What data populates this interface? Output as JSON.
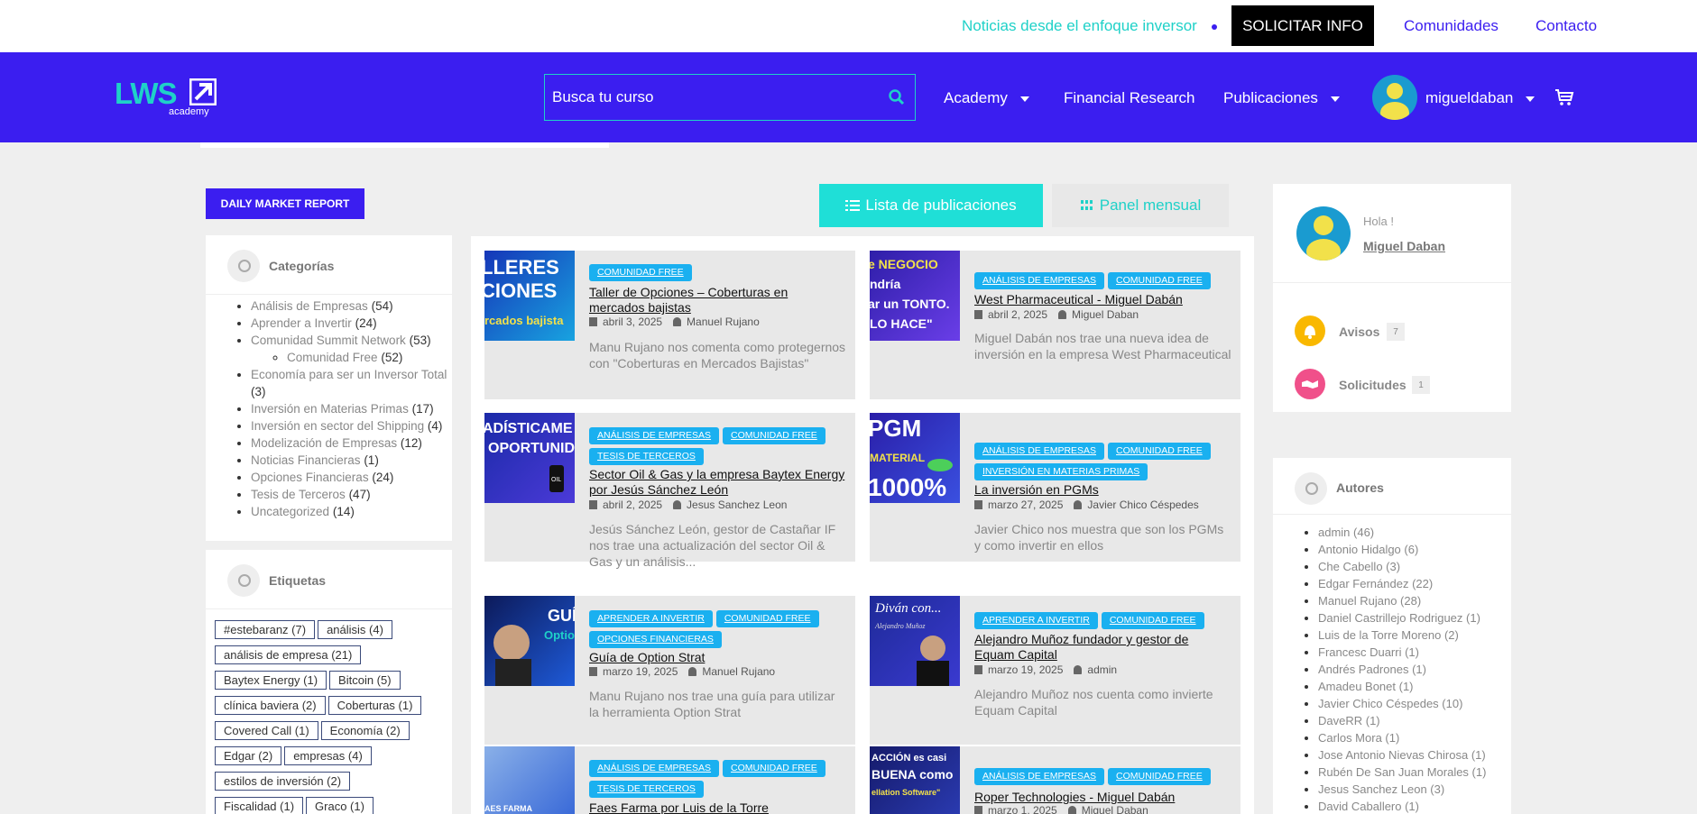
{
  "topbar": {
    "tagline": "Noticias desde el enfoque inversor",
    "cta": "SOLICITAR INFO",
    "links": [
      "Comunidades",
      "Contacto"
    ]
  },
  "header": {
    "logo_main": "LWS",
    "logo_sub": "academy",
    "search_placeholder": "Busca tu curso",
    "nav": [
      "Academy",
      "Financial Research",
      "Publicaciones"
    ],
    "user": "migueldaban",
    "colors": {
      "primary": "#3b1ef0",
      "accent": "#1fd1c8"
    }
  },
  "left": {
    "daily_button": "DAILY MARKET REPORT",
    "categorias_title": "Categorías",
    "categories": [
      {
        "name": "Análisis de Empresas",
        "count": "(54)"
      },
      {
        "name": "Aprender a Invertir",
        "count": "(24)"
      },
      {
        "name": "Comunidad Summit Network",
        "count": "(53)"
      },
      {
        "name": "Comunidad Free",
        "count": "(52)"
      },
      {
        "name": "Economía para ser un Inversor Total",
        "count": "(3)"
      },
      {
        "name": "Inversión en Materias Primas",
        "count": "(17)"
      },
      {
        "name": "Inversión en sector del Shipping",
        "count": "(4)"
      },
      {
        "name": "Modelización de Empresas",
        "count": "(12)"
      },
      {
        "name": "Noticias Financieras",
        "count": "(1)"
      },
      {
        "name": "Opciones Financieras",
        "count": "(24)"
      },
      {
        "name": "Tesis de Terceros",
        "count": "(47)"
      },
      {
        "name": "Uncategorized",
        "count": "(14)"
      }
    ],
    "etiquetas_title": "Etiquetas",
    "tags": [
      "#estebaranz (7)",
      "análisis (4)",
      "análisis de empresa (21)",
      "Baytex Energy (1)",
      "Bitcoin (5)",
      "clínica baviera (2)",
      "Coberturas (1)",
      "Covered Call (1)",
      "Economía (2)",
      "Edgar (2)",
      "empresas (4)",
      "estilos de inversión (2)",
      "Fiscalidad (1)",
      "Graco (1)"
    ]
  },
  "toggle": {
    "list": "Lista de publicaciones",
    "panel": "Panel mensual"
  },
  "posts": [
    {
      "thumb": "LLERES|CIONES|rcados bajista",
      "badges": [
        "COMUNIDAD FREE"
      ],
      "title": "Taller de Opciones – Coberturas en mercados bajistas",
      "date": "abril 3, 2025",
      "author": "Manuel Rujano",
      "excerpt": "Manu Rujano nos comenta como protegernos con \"Coberturas en Mercados Bajistas\""
    },
    {
      "thumb": "e NEGOCIO|ndría|ar un TONTO.|LO HACE\"",
      "badges": [
        "ANÁLISIS DE EMPRESAS",
        "COMUNIDAD FREE"
      ],
      "title": "West Pharmaceutical - Miguel Dabán",
      "date": "abril 2, 2025",
      "author": "Miguel Daban",
      "excerpt": "Miguel Dabán nos trae una nueva idea de inversión en la empresa West Pharmaceutical"
    },
    {
      "thumb": "ADÍSTICAME|OPORTUNIDA",
      "badges": [
        "ANÁLISIS DE EMPRESAS",
        "COMUNIDAD FREE",
        "TESIS DE TERCEROS"
      ],
      "title": "Sector Oil & Gas y la empresa Baytex Energy por Jesús Sánchez León",
      "date": "abril 2, 2025",
      "author": "Jesus Sanchez Leon",
      "excerpt": "Jesús Sánchez León, gestor de Castañar IF nos trae una actualización del sector Oil & Gas y un análisis..."
    },
    {
      "thumb": "PGM|MATERIAL|1000%",
      "badges": [
        "ANÁLISIS DE EMPRESAS",
        "COMUNIDAD FREE",
        "INVERSIÓN EN MATERIAS PRIMAS"
      ],
      "title": "La inversión en PGMs",
      "date": "marzo 27, 2025",
      "author": "Javier Chico Céspedes",
      "excerpt": "Javier Chico nos muestra que son los PGMs y como invertir en ellos"
    },
    {
      "thumb": "GUÍA|Option",
      "badges": [
        "APRENDER A INVERTIR",
        "COMUNIDAD FREE",
        "OPCIONES FINANCIERAS"
      ],
      "title": "Guía de Option Strat",
      "date": "marzo 19, 2025",
      "author": "Manuel Rujano",
      "excerpt": "Manu Rujano nos trae una guía para utilizar la herramienta Option Strat"
    },
    {
      "thumb": "Diván con...|Alejandro Muñoz",
      "badges": [
        "APRENDER A INVERTIR",
        "COMUNIDAD FREE"
      ],
      "title": "Alejandro Muñoz fundador y gestor de Equam Capital",
      "date": "marzo 19, 2025",
      "author": "admin",
      "excerpt": "Alejandro Muñoz nos cuenta como invierte Equam Capital"
    },
    {
      "thumb": "AES FARMA",
      "badges": [
        "ANÁLISIS DE EMPRESAS",
        "COMUNIDAD FREE",
        "TESIS DE TERCEROS"
      ],
      "title": "Faes Farma por Luis de la Torre",
      "date": "",
      "author": "",
      "excerpt": ""
    },
    {
      "thumb": "ACCIÓN es casi|BUENA como|ellation Software\"",
      "badges": [
        "ANÁLISIS DE EMPRESAS",
        "COMUNIDAD FREE"
      ],
      "title": "Roper Technologies - Miguel Dabán",
      "date": "marzo 1, 2025",
      "author": "Miguel Daban",
      "excerpt": ""
    }
  ],
  "right": {
    "hola": "Hola !",
    "name": "Miguel Daban",
    "avisos": "Avisos",
    "avisos_count": "7",
    "solicitudes": "Solicitudes",
    "solicitudes_count": "1",
    "autores_title": "Autores",
    "authors": [
      "admin (46)",
      "Antonio Hidalgo (6)",
      "Che Cabello (3)",
      "Edgar Fernández (22)",
      "Manuel Rujano (28)",
      "Daniel Castrillejo Rodriguez (1)",
      "Luis de la Torre Moreno (2)",
      "Francesc Duarri (1)",
      "Andrés Padrones (1)",
      "Amadeu Bonet (1)",
      "Javier Chico Céspedes (10)",
      "DaveRR (1)",
      "Carlos Mora (1)",
      "Jose Antonio Nievas Chirosa (1)",
      "Rubén De San Juan Morales (1)",
      "Jesus Sanchez Leon (3)",
      "David Caballero (1)"
    ]
  }
}
